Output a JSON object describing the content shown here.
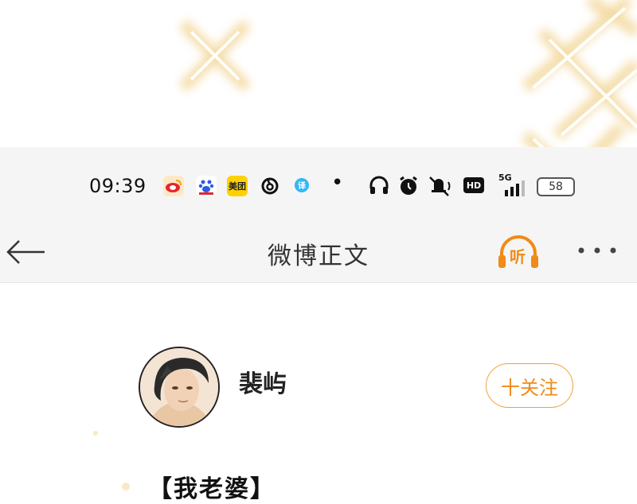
{
  "status_bar": {
    "time": "09:39",
    "app_icons": [
      "weibo-icon",
      "baidu-icon",
      "meituan-icon",
      "netease-music-icon",
      "translate-icon"
    ],
    "meituan_label": "美团",
    "dot": "•",
    "battery": "58",
    "network": "5G",
    "hd": "HD"
  },
  "nav": {
    "title": "微博正文",
    "listen_label": "听",
    "more_label": "···"
  },
  "author": {
    "name": "裴屿",
    "follow_label": "十关注"
  },
  "post": {
    "title": "【我老婆】"
  },
  "colors": {
    "accent": "#f08a18",
    "header_bg": "#f5f5f5",
    "gold_decor": "#f3d79a"
  }
}
